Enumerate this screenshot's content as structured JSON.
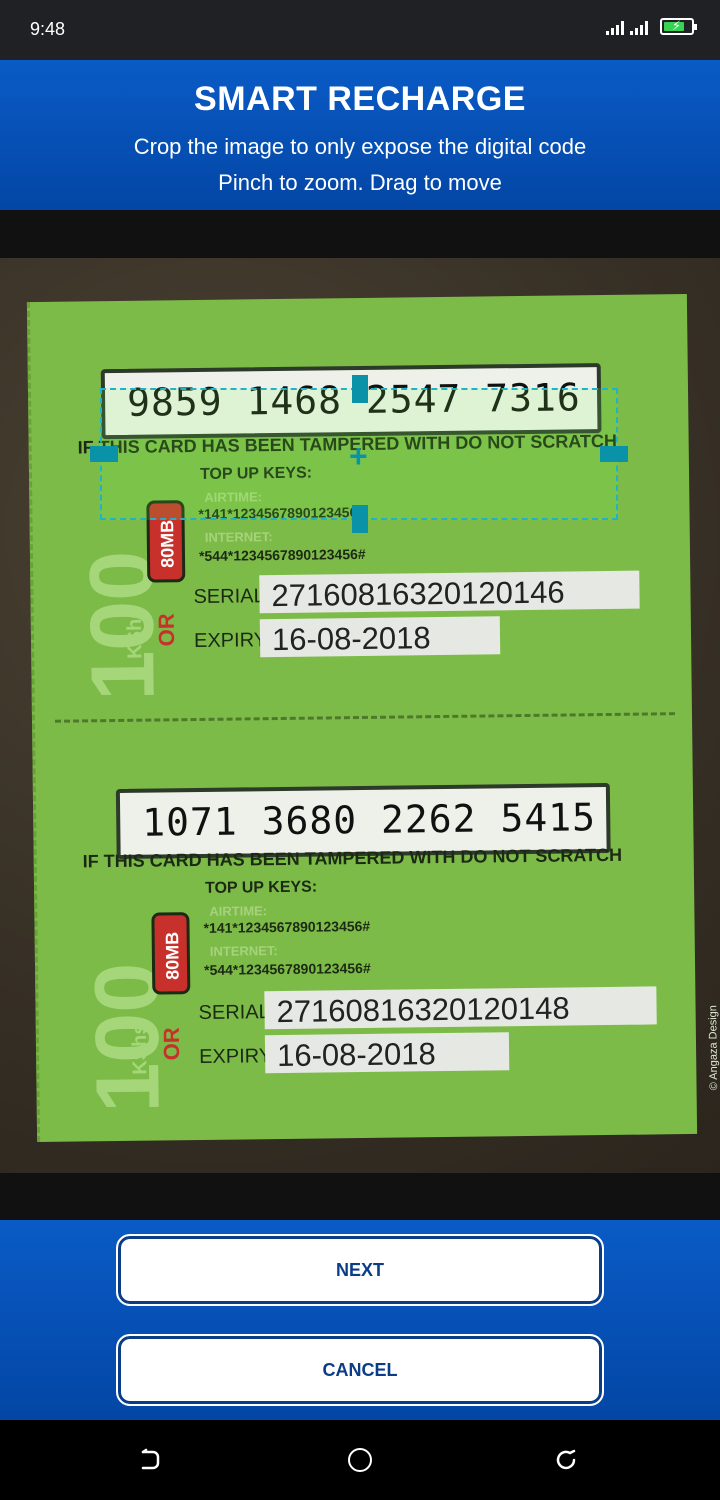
{
  "status": {
    "time": "9:48"
  },
  "header": {
    "title": "SMART RECHARGE",
    "subtitle_line1": "Crop the image to only expose the digital code",
    "subtitle_line2": "Pinch to zoom. Drag to move"
  },
  "card": {
    "top": {
      "pin": "9859 1468 2547 7316",
      "tamper_warning": "IF THIS CARD HAS BEEN TAMPERED WITH DO NOT SCRATCH",
      "keys_title": "TOP UP KEYS:",
      "airtime_label": "AIRTIME:",
      "airtime_code": "*141*1234567890123456#",
      "internet_label": "INTERNET:",
      "internet_code": "*544*1234567890123456#",
      "serial_label": "SERIAL",
      "serial": "27160816320120146",
      "expiry_label": "EXPIRY",
      "expiry": "16-08-2018",
      "amount": "100",
      "currency": "KShs",
      "or_text": "OR",
      "bundle": "80MB"
    },
    "bottom": {
      "pin": "1071 3680 2262 5415",
      "tamper_warning": "IF THIS CARD HAS BEEN TAMPERED WITH DO NOT SCRATCH",
      "keys_title": "TOP UP KEYS:",
      "airtime_label": "AIRTIME:",
      "airtime_code": "*141*1234567890123456#",
      "internet_label": "INTERNET:",
      "internet_code": "*544*1234567890123456#",
      "serial_label": "SERIAL",
      "serial": "27160816320120148",
      "expiry_label": "EXPIRY",
      "expiry": "16-08-2018",
      "amount": "100",
      "currency": "KShs",
      "or_text": "OR",
      "bundle": "80MB"
    },
    "designer_credit": "© Angaza Design"
  },
  "crop": {
    "center_glyph": "+"
  },
  "buttons": {
    "next": "NEXT",
    "cancel": "CANCEL"
  },
  "colors": {
    "header_blue": "#0a5bc6",
    "crop_accent": "#0a93a8",
    "button_text": "#0b3d87",
    "card_green": "#7dbb49"
  },
  "icons": {
    "nav_back": "back-icon",
    "nav_home": "home-icon",
    "nav_recent": "recent-apps-icon"
  }
}
